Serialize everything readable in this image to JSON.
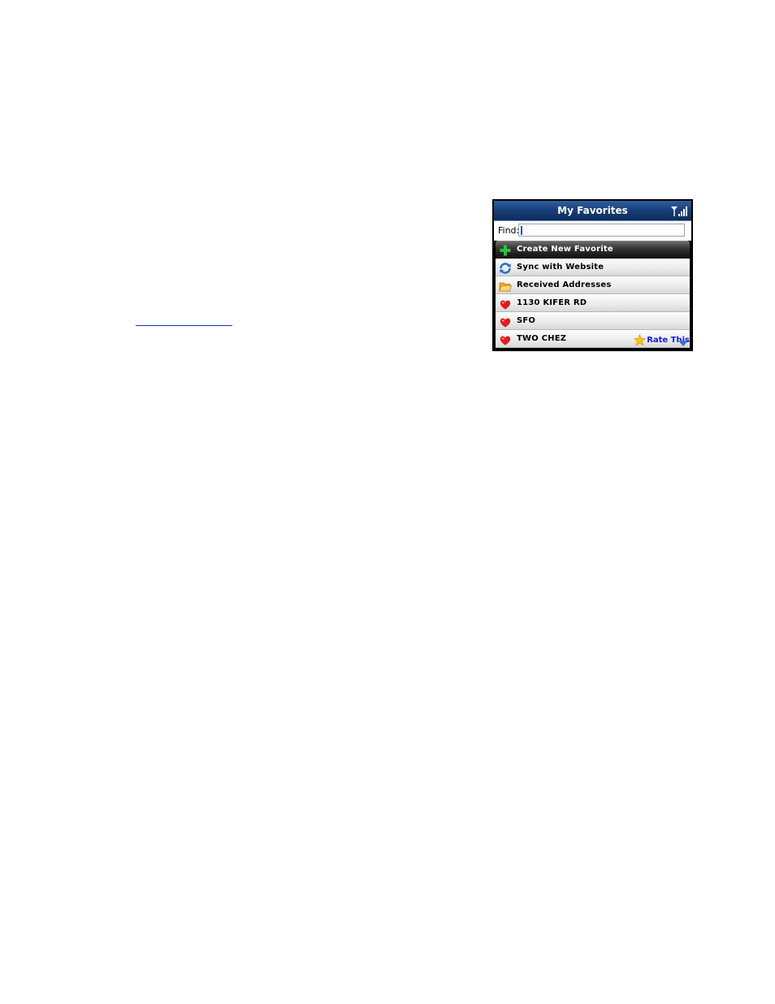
{
  "document": {
    "link_text": ""
  },
  "app": {
    "title": "My Favorites",
    "status_icon": "signal-strength-icon",
    "accent_color": "#173f78"
  },
  "find": {
    "label": "Find:",
    "value": "",
    "placeholder": ""
  },
  "list": {
    "items": [
      {
        "label": "Create New Favorite",
        "icon": "plus-icon",
        "selected": true
      },
      {
        "label": "Sync with Website",
        "icon": "sync-icon",
        "selected": false
      },
      {
        "label": "Received Addresses",
        "icon": "folder-icon",
        "selected": false
      },
      {
        "label": "1130 KIFER RD",
        "icon": "heart-icon",
        "selected": false
      },
      {
        "label": "SFO",
        "icon": "heart-icon",
        "selected": false
      },
      {
        "label": "TWO CHEZ",
        "icon": "heart-icon",
        "selected": false
      }
    ],
    "rate_label": "Rate This",
    "rate_icon": "star-icon",
    "scroll_icon": "scroll-down-arrow-icon"
  }
}
